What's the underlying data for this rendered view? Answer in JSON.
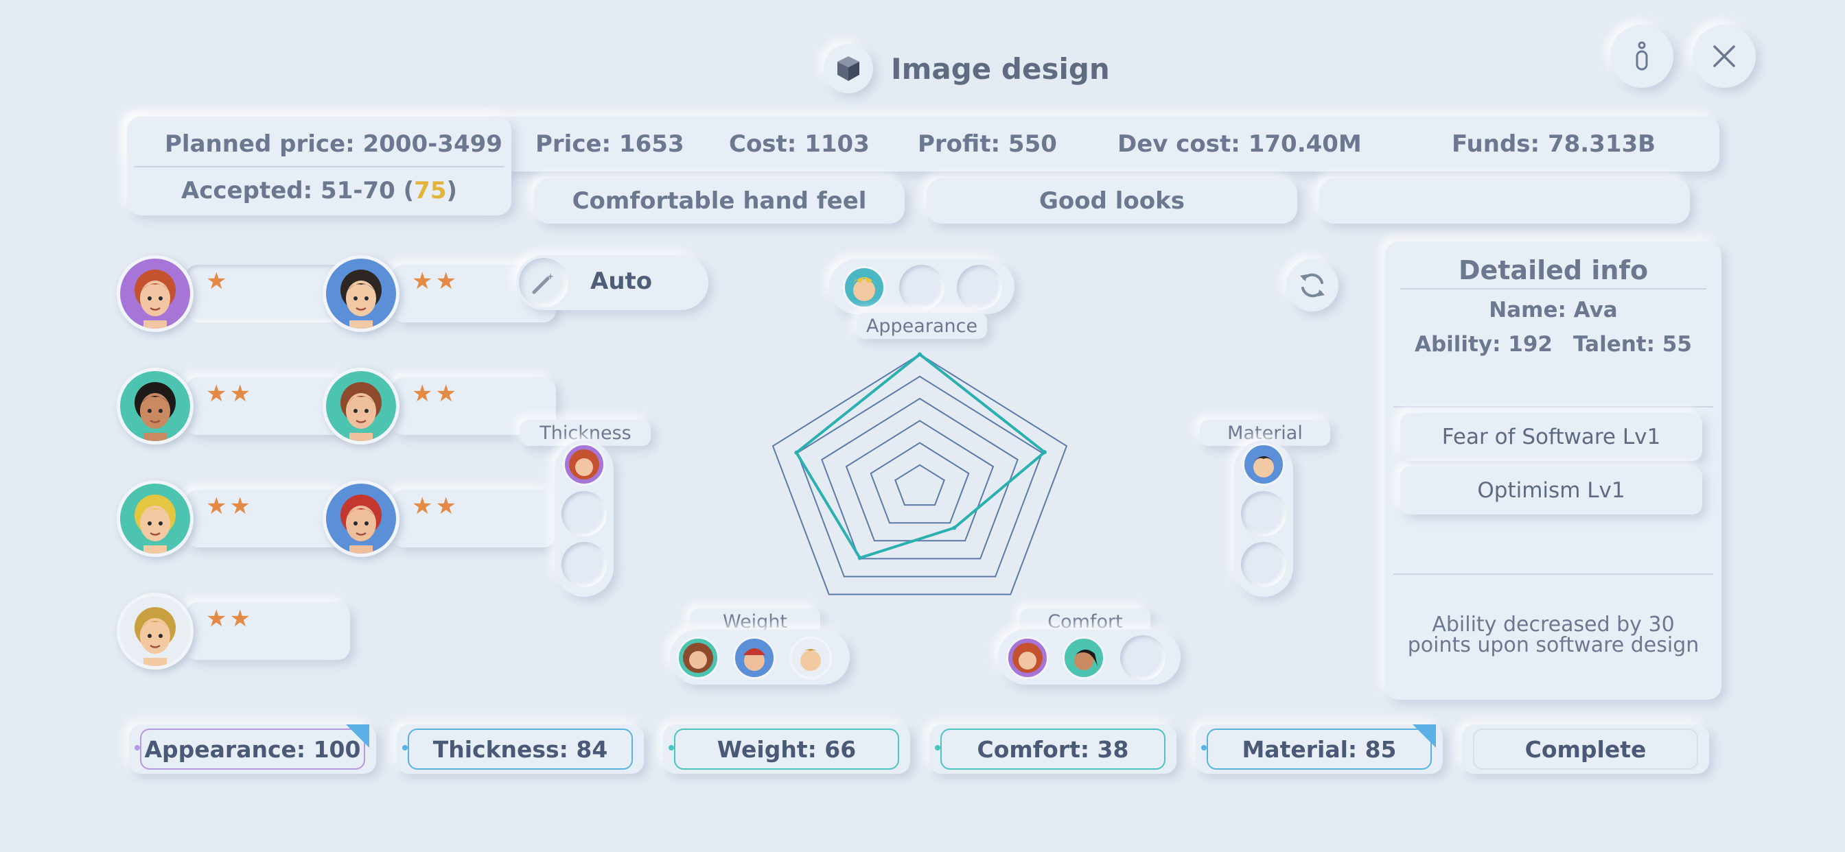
{
  "header": {
    "title": "Image design",
    "title_icon": "cube-icon",
    "info_icon": "info-icon",
    "close_icon": "close-icon"
  },
  "stats": {
    "planned_price": "Planned price: 2000-3499",
    "accepted_prefix": "Accepted: 51-70 (",
    "accepted_value": "75",
    "accepted_suffix": ")",
    "price": "Price: 1653",
    "cost": "Cost: 1103",
    "profit": "Profit: 550",
    "dev_cost": "Dev cost: 170.40M",
    "funds": "Funds: 78.313B"
  },
  "features": [
    "Comfortable hand feel",
    "Good looks",
    ""
  ],
  "developers": [
    {
      "name": "dev-ava",
      "stars": "★",
      "avatar": "red-curly-hair-woman-glasses"
    },
    {
      "name": "dev-2",
      "stars": "★★",
      "avatar": "dark-hair-man-glasses"
    },
    {
      "name": "dev-3",
      "stars": "★★",
      "avatar": "ponytail-woman"
    },
    {
      "name": "dev-4",
      "stars": "★★",
      "avatar": "long-brown-hair-woman"
    },
    {
      "name": "dev-5",
      "stars": "★★",
      "avatar": "blond-spiky-hair-man"
    },
    {
      "name": "dev-6",
      "stars": "★★",
      "avatar": "red-beanie-woman-glasses"
    },
    {
      "name": "dev-7",
      "stars": "★★",
      "avatar": "blond-hair-man-glasses"
    }
  ],
  "controls": {
    "auto_label": "Auto",
    "auto_icon": "magic-wand-icon",
    "refresh_icon": "refresh-icon"
  },
  "slots": {
    "appearance": "Appearance",
    "thickness": "Thickness",
    "material": "Material",
    "weight": "Weight",
    "comfort": "Comfort"
  },
  "chart_data": {
    "type": "radar",
    "axes": [
      "Appearance",
      "Material",
      "Comfort",
      "Weight",
      "Thickness"
    ],
    "values": [
      100,
      85,
      38,
      66,
      84
    ],
    "max": 100,
    "rings": 6,
    "series_color": "#2bb0b0",
    "grid_color": "#5b7aa8"
  },
  "info": {
    "heading": "Detailed info",
    "name": "Name: Ava",
    "ability": "Ability: 192",
    "talent": "Talent: 55",
    "traits": [
      "Fear of Software  Lv1",
      "Optimism  Lv1"
    ],
    "note_line1": "Ability decreased by 30",
    "note_line2": "points upon software design"
  },
  "attributes": [
    {
      "label": "Appearance: 100",
      "color": "#b49ae0",
      "corner": true
    },
    {
      "label": "Thickness: 84",
      "color": "#58b2e0",
      "corner": false
    },
    {
      "label": "Weight: 66",
      "color": "#4cc4c0",
      "corner": false
    },
    {
      "label": "Comfort: 38",
      "color": "#4cc4c0",
      "corner": false
    },
    {
      "label": "Material: 85",
      "color": "#58b2e0",
      "corner": true
    }
  ],
  "complete_label": "Complete"
}
